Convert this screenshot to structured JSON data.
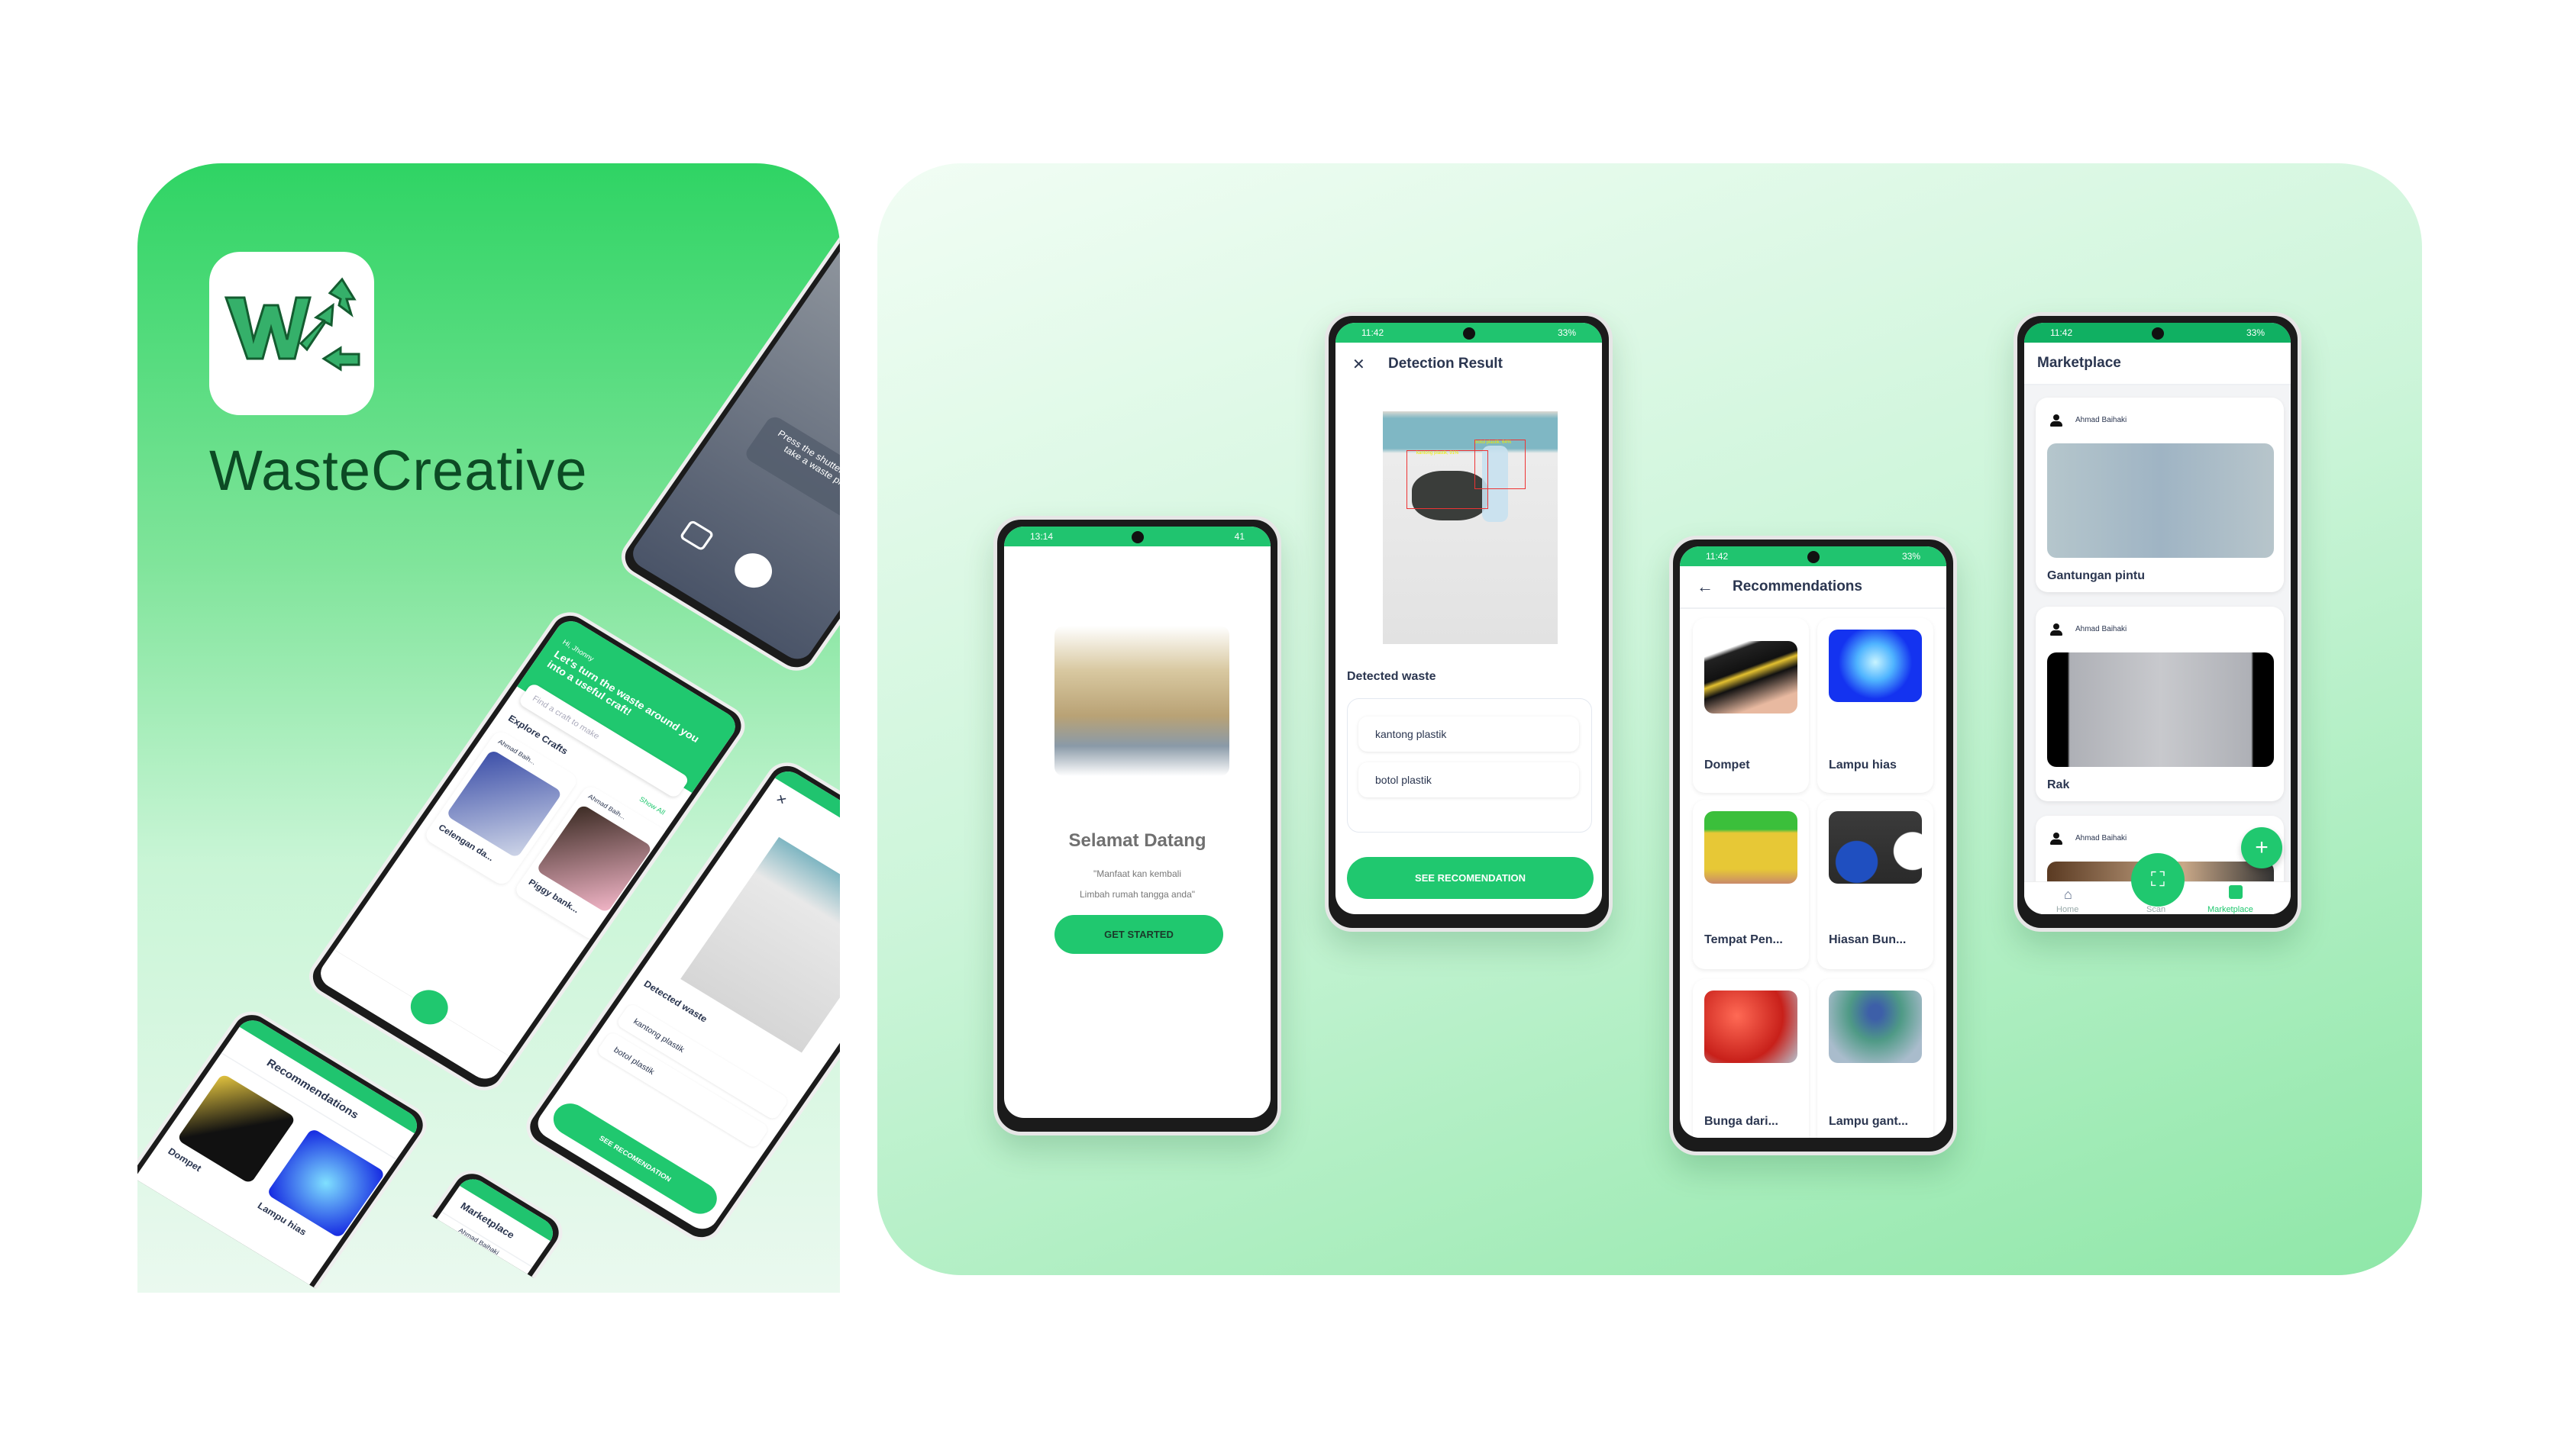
{
  "brand": {
    "name": "WasteCreative",
    "logo_letter": "W"
  },
  "colors": {
    "primary": "#20c86f",
    "brand_dark": "#0c4a24"
  },
  "welcome": {
    "time": "13:14",
    "battery": "41",
    "title": "Selamat Datang",
    "quote_line1": "\"Manfaat kan kembali",
    "quote_line2": "Limbah rumah tangga anda\"",
    "button": "GET STARTED"
  },
  "detection": {
    "time": "11:42",
    "battery": "33%",
    "title": "Detection Result",
    "close_icon": "close-icon",
    "box1": "kantong plastik, 91%",
    "box2": "botol plastik, 64%",
    "section": "Detected waste",
    "items": [
      "kantong plastik",
      "botol plastik"
    ],
    "button": "SEE RECOMENDATION"
  },
  "recommendations": {
    "time": "11:42",
    "battery": "33%",
    "title": "Recommendations",
    "items": [
      "Dompet",
      "Lampu hias",
      "Tempat Pen...",
      "Hiasan Bun...",
      "Bunga dari...",
      "Lampu gant..."
    ]
  },
  "marketplace": {
    "time": "11:42",
    "battery": "33%",
    "title": "Marketplace",
    "posts": [
      {
        "author": "Ahmad Baihaki",
        "title": "Gantungan pintu"
      },
      {
        "author": "Ahmad Baihaki",
        "title": "Rak"
      },
      {
        "author": "Ahmad Baihaki",
        "title": ""
      }
    ],
    "nav": [
      "Home",
      "Scan",
      "Marketplace"
    ]
  },
  "mock": {
    "camera_hint": "Press the shutter button to take a waste picture",
    "greeting": "Hi, Jhonny",
    "headline": "Let's turn the waste around you into a useful craft!",
    "search_placeholder": "Find a craft to make",
    "explore": "Explore Crafts",
    "show_all": "Show All",
    "author_short": "Ahmad Baih...",
    "crafts": [
      "Celengan da...",
      "Piggy bank..."
    ]
  }
}
